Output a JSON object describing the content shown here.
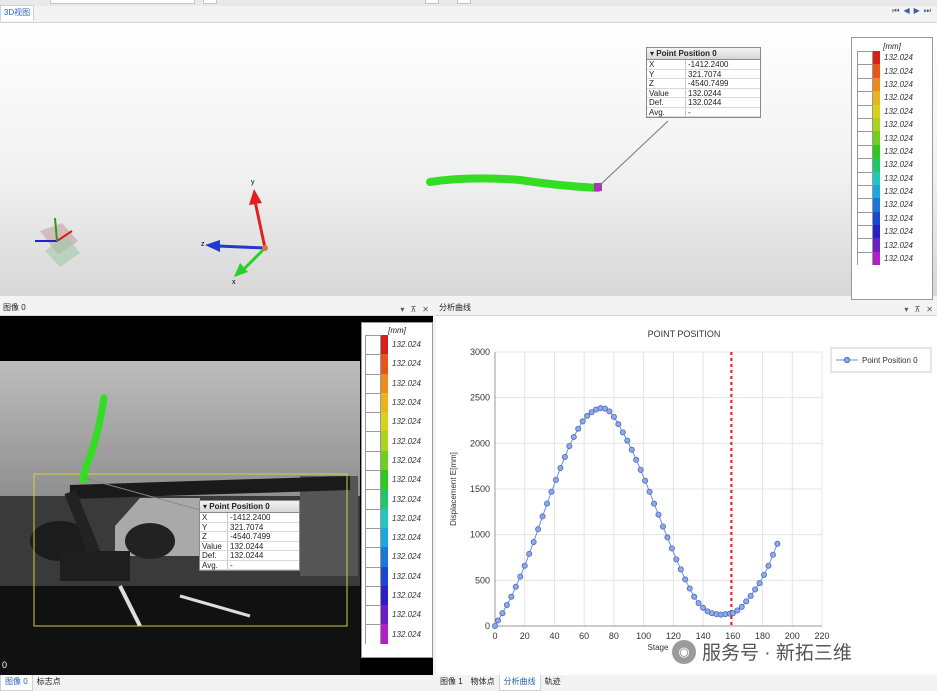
{
  "view3d": {
    "tab_label": "3D视图",
    "nav_buttons": [
      "⏮",
      "◀",
      "▶",
      "⏭"
    ],
    "axes": {
      "y": "y",
      "z": "z",
      "x": "x"
    }
  },
  "point_info": {
    "title": "Point Position 0",
    "rows": [
      {
        "key": "X",
        "value": "-1412.2400"
      },
      {
        "key": "Y",
        "value": "321.7074"
      },
      {
        "key": "Z",
        "value": "-4540.7499"
      },
      {
        "key": "Value",
        "value": "132.0244"
      },
      {
        "key": "Def.",
        "value": "132.0244"
      },
      {
        "key": "Avg.",
        "value": "-"
      }
    ]
  },
  "legend": {
    "unit": "[mm]",
    "values": [
      "132.024",
      "132.024",
      "132.024",
      "132.024",
      "132.024",
      "132.024",
      "132.024",
      "132.024",
      "132.024",
      "132.024",
      "132.024",
      "132.024",
      "132.024",
      "132.024",
      "132.024",
      "132.024"
    ],
    "colors": [
      "#d8201a",
      "#e8551a",
      "#ec8a1a",
      "#e9b41c",
      "#d9d01a",
      "#a9d41a",
      "#6fcf1c",
      "#2ec81e",
      "#22c66a",
      "#1fc7bf",
      "#1ba8dc",
      "#1b78d8",
      "#1b48cf",
      "#2a1fc4",
      "#6a1fc4",
      "#b21fc9"
    ]
  },
  "image_panel": {
    "title": "图像 0",
    "frame_index": "0"
  },
  "chart_panel": {
    "title": "分析曲线"
  },
  "panel_controls": {
    "pin": "⊼",
    "close": "✕"
  },
  "bottom_tabs_left": [
    "图像 0",
    "标志点"
  ],
  "bottom_tabs_right": [
    "图像 1",
    "物体点",
    "分析曲线",
    "轨迹"
  ],
  "watermark": "服务号 · 新拓三维",
  "colors": {
    "accent": "#2a62b8",
    "series": "#6f8fd9",
    "marker_line": "#e02020",
    "trajectory": "#33dd22"
  },
  "chart_data": {
    "type": "scatter",
    "title": "POINT POSITION",
    "xlabel": "Stage",
    "ylabel": "Displacement E[mm]",
    "xlim": [
      0,
      220
    ],
    "ylim": [
      0,
      3000
    ],
    "xticks": [
      0,
      20,
      40,
      60,
      80,
      100,
      120,
      140,
      160,
      180,
      200,
      220
    ],
    "yticks": [
      0,
      500,
      1000,
      1500,
      2000,
      2500,
      3000
    ],
    "grid": true,
    "legend_position": "top-right",
    "marker_x": 159,
    "series": [
      {
        "name": "Point Position 0",
        "x": [
          0,
          2,
          5,
          8,
          11,
          14,
          17,
          20,
          23,
          26,
          29,
          32,
          35,
          38,
          41,
          44,
          47,
          50,
          53,
          56,
          59,
          62,
          65,
          68,
          71,
          74,
          77,
          80,
          83,
          86,
          89,
          92,
          95,
          98,
          101,
          104,
          107,
          110,
          113,
          116,
          119,
          122,
          125,
          128,
          131,
          134,
          137,
          140,
          143,
          146,
          149,
          152,
          155,
          158,
          160,
          163,
          166,
          169,
          172,
          175,
          178,
          181,
          184,
          187,
          190
        ],
        "y": [
          0,
          60,
          140,
          230,
          320,
          430,
          540,
          660,
          790,
          920,
          1060,
          1200,
          1340,
          1470,
          1600,
          1730,
          1850,
          1970,
          2070,
          2160,
          2240,
          2300,
          2340,
          2370,
          2385,
          2380,
          2350,
          2290,
          2210,
          2120,
          2030,
          1930,
          1820,
          1710,
          1590,
          1470,
          1340,
          1220,
          1090,
          970,
          850,
          730,
          620,
          510,
          410,
          320,
          250,
          200,
          160,
          140,
          130,
          125,
          130,
          135,
          140,
          170,
          210,
          270,
          330,
          400,
          470,
          560,
          660,
          780,
          900
        ]
      }
    ]
  }
}
